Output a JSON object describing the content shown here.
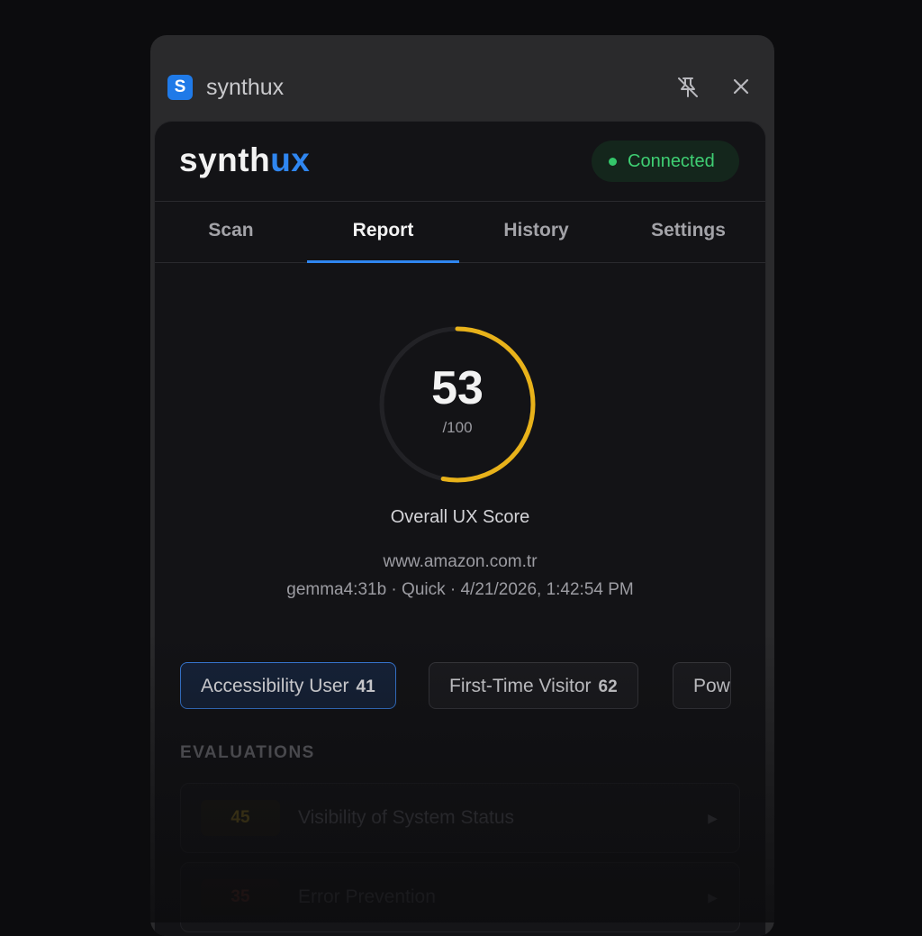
{
  "window": {
    "app_icon_letter": "S",
    "app_name": "synthux",
    "pin_icon": "pin-off-icon",
    "close_icon": "close-icon"
  },
  "header": {
    "brand_prefix": "synth",
    "brand_suffix": "ux",
    "brand_accent_color": "#2f86f0",
    "status_label": "Connected",
    "status_color": "#3fcf73"
  },
  "tabs": [
    {
      "label": "Scan",
      "active": false
    },
    {
      "label": "Report",
      "active": true
    },
    {
      "label": "History",
      "active": false
    },
    {
      "label": "Settings",
      "active": false
    }
  ],
  "score": {
    "value": "53",
    "max_label": "/100",
    "fraction": 0.53,
    "ring_color": "#e8b21a",
    "label": "Overall UX Score"
  },
  "report": {
    "url": "www.amazon.com.tr",
    "meta": "gemma4:31b · Quick · 4/21/2026, 1:42:54 PM"
  },
  "personas": [
    {
      "label": "Accessibility User",
      "score": "41",
      "active": true
    },
    {
      "label": "First-Time Visitor",
      "score": "62",
      "active": false
    },
    {
      "label": "Pow",
      "score": "",
      "active": false
    }
  ],
  "evaluations": {
    "section_title": "EVALUATIONS",
    "items": [
      {
        "score": "45",
        "title": "Visibility of System Status",
        "score_color": "#6b5a1e"
      },
      {
        "score": "35",
        "title": "Error Prevention",
        "score_color": "#5a2a22"
      }
    ]
  }
}
